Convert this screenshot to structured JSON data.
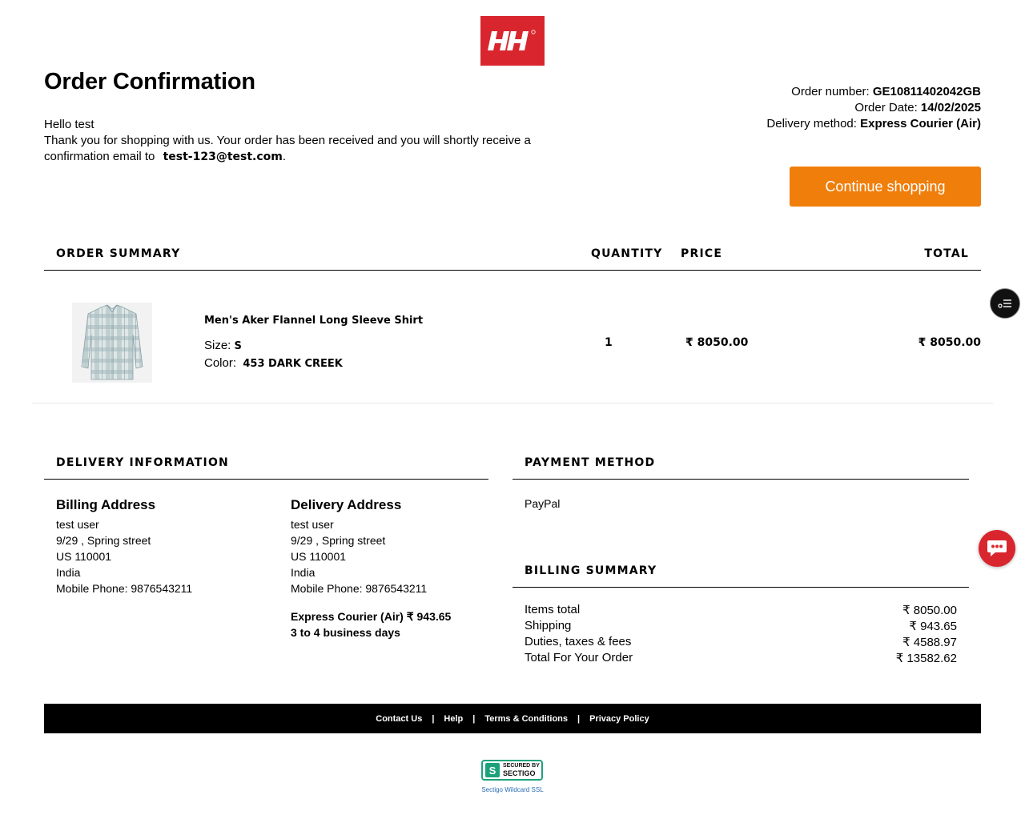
{
  "brand": {
    "logo_text": "HH",
    "accent": "#d9262e",
    "button_color": "#f07e0b"
  },
  "header": {
    "title": "Order Confirmation",
    "greeting": "Hello test",
    "message": "Thank you for shopping with us. Your order has been received and you will shortly receive a confirmation email to",
    "email": "test-123@test.com",
    "email_suffix": ".",
    "order_number_label": "Order number:",
    "order_number": "GE10811402042GB",
    "order_date_label": "Order Date:",
    "order_date": "14/02/2025",
    "delivery_method_label": "Delivery method:",
    "delivery_method": "Express Courier (Air)",
    "continue_label": "Continue shopping"
  },
  "order_summary": {
    "headers": {
      "summary": "ORDER SUMMARY",
      "quantity": "QUANTITY",
      "price": "PRICE",
      "total": "TOTAL"
    },
    "items": [
      {
        "name": "Men's Aker Flannel Long Sleeve Shirt",
        "size_label": "Size:",
        "size": "S",
        "color_label": "Color:",
        "color": "453 DARK CREEK",
        "quantity": "1",
        "price": "₹ 8050.00",
        "total": "₹ 8050.00"
      }
    ]
  },
  "delivery_info": {
    "heading": "DELIVERY INFORMATION",
    "billing": {
      "title": "Billing Address",
      "name": "test user",
      "street": "9/29 , Spring street",
      "zip": "US 110001",
      "country": "India",
      "phone": "Mobile Phone: 9876543211"
    },
    "delivery": {
      "title": "Delivery Address",
      "name": "test user",
      "street": "9/29 , Spring street",
      "zip": "US 110001",
      "country": "India",
      "phone": "Mobile Phone: 9876543211",
      "courier": "Express Courier (Air) ₹ 943.65",
      "eta": "3 to 4 business days"
    }
  },
  "payment": {
    "heading": "PAYMENT METHOD",
    "method": "PayPal"
  },
  "billing_summary": {
    "heading": "BILLING SUMMARY",
    "rows": [
      {
        "label": "Items total",
        "value": "₹ 8050.00"
      },
      {
        "label": "Shipping",
        "value": "₹ 943.65"
      },
      {
        "label": "Duties, taxes & fees",
        "value": "₹ 4588.97"
      },
      {
        "label": "Total For Your Order",
        "value": "₹ 13582.62"
      }
    ]
  },
  "footer": {
    "links": [
      "Contact Us",
      "Help",
      "Terms & Conditions",
      "Privacy Policy"
    ],
    "separator": "|"
  },
  "ssl": {
    "line1": "SECURED BY",
    "line2": "SECTIGO",
    "link": "Sectigo Wildcard SSL"
  },
  "icons": {
    "side": "checklist-icon",
    "chat": "chat-bubble-icon"
  }
}
